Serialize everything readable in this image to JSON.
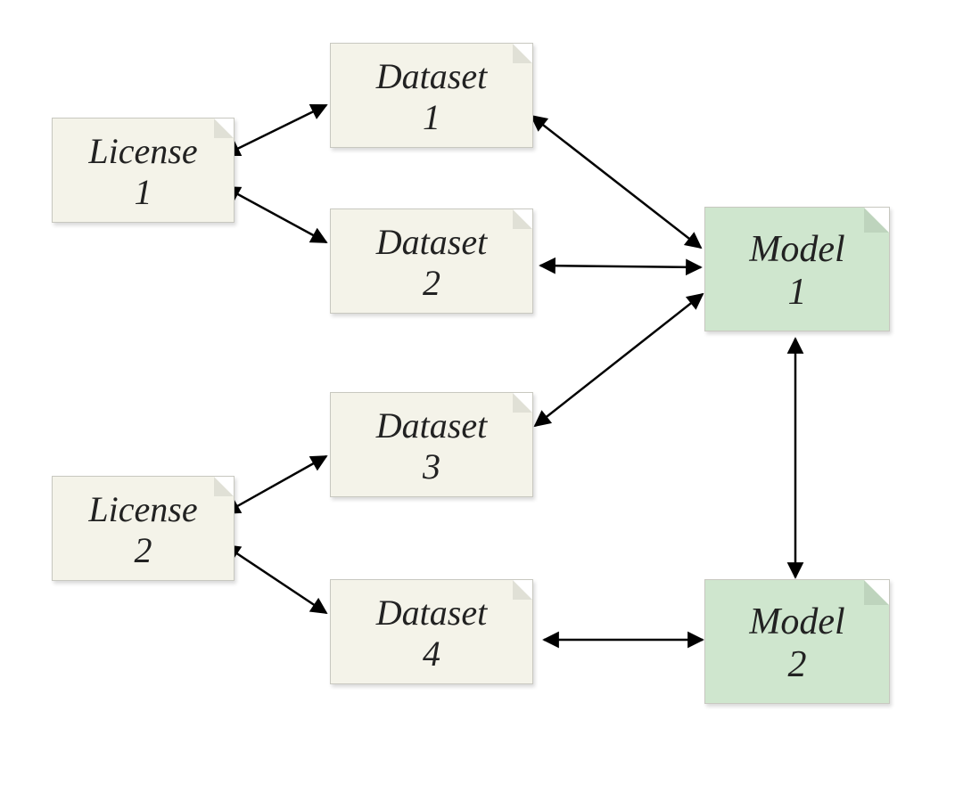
{
  "nodes": {
    "license1": {
      "line1": "License",
      "line2": "1"
    },
    "license2": {
      "line1": "License",
      "line2": "2"
    },
    "dataset1": {
      "line1": "Dataset",
      "line2": "1"
    },
    "dataset2": {
      "line1": "Dataset",
      "line2": "2"
    },
    "dataset3": {
      "line1": "Dataset",
      "line2": "3"
    },
    "dataset4": {
      "line1": "Dataset",
      "line2": "4"
    },
    "model1": {
      "line1": "Model",
      "line2": "1"
    },
    "model2": {
      "line1": "Model",
      "line2": "2"
    }
  },
  "edges": [
    {
      "from": "license1",
      "to": "dataset1",
      "bidirectional": true
    },
    {
      "from": "license1",
      "to": "dataset2",
      "bidirectional": true
    },
    {
      "from": "license2",
      "to": "dataset3",
      "bidirectional": true
    },
    {
      "from": "license2",
      "to": "dataset4",
      "bidirectional": true
    },
    {
      "from": "dataset1",
      "to": "model1",
      "bidirectional": true
    },
    {
      "from": "dataset2",
      "to": "model1",
      "bidirectional": true
    },
    {
      "from": "dataset3",
      "to": "model1",
      "bidirectional": true
    },
    {
      "from": "dataset4",
      "to": "model2",
      "bidirectional": true
    },
    {
      "from": "model1",
      "to": "model2",
      "bidirectional": true
    }
  ],
  "colors": {
    "license_fill": "#f4f3e9",
    "dataset_fill": "#f4f3e9",
    "model_fill": "#cfe6ce",
    "edge_stroke": "#000000"
  }
}
